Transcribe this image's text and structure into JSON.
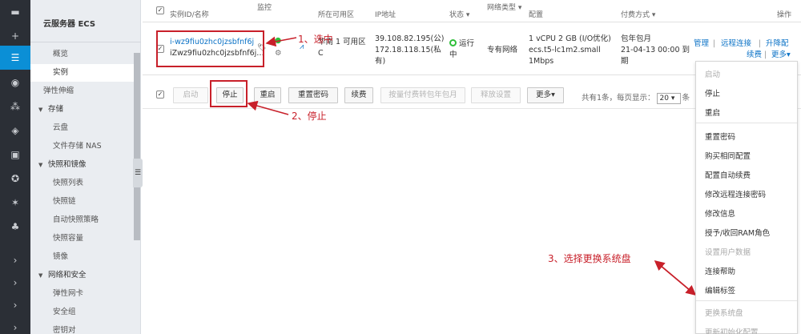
{
  "sidebar": {
    "title": "云服务器 ECS",
    "items": [
      {
        "label": "概览",
        "kind": "item"
      },
      {
        "label": "实例",
        "kind": "item",
        "active": true
      },
      {
        "label": "弹性伸缩",
        "kind": "item"
      },
      {
        "label": "存储",
        "kind": "group"
      },
      {
        "label": "云盘",
        "kind": "sub"
      },
      {
        "label": "文件存储 NAS",
        "kind": "sub"
      },
      {
        "label": "快照和镜像",
        "kind": "group"
      },
      {
        "label": "快照列表",
        "kind": "sub"
      },
      {
        "label": "快照链",
        "kind": "sub"
      },
      {
        "label": "自动快照策略",
        "kind": "sub"
      },
      {
        "label": "快照容量",
        "kind": "sub"
      },
      {
        "label": "镜像",
        "kind": "sub"
      },
      {
        "label": "网络和安全",
        "kind": "group"
      },
      {
        "label": "弹性网卡",
        "kind": "sub"
      },
      {
        "label": "安全组",
        "kind": "sub"
      },
      {
        "label": "密钥对",
        "kind": "sub"
      }
    ]
  },
  "table": {
    "headers": {
      "id": "实例ID/名称",
      "monitor": "监控",
      "zone": "所在可用区",
      "ip": "IP地址",
      "status": "状态 ▾",
      "network": "网络类型 ▾",
      "config": "配置",
      "billing": "付费方式 ▾",
      "ops": "操作"
    },
    "row": {
      "id_line1": "i-wz9fiu0zhc0jzsbfnf6j",
      "id_line2": "iZwz9fiu0zhc0jzsbfnf6j…",
      "zone_line1": "华南 1 可用区",
      "zone_line2": "C",
      "ip_line1": "39.108.82.195(公)",
      "ip_line2": "172.18.118.15(私",
      "ip_line3": "有)",
      "status_line1": "运行",
      "status_line2": "中",
      "network": "专有网络",
      "config_line1": "1 vCPU 2 GB (I/O优化)",
      "config_line2": "ecs.t5-lc1m2.small",
      "config_line3": "1Mbps",
      "billing_line1": "包年包月",
      "billing_line2": "21-04-13 00:00 到",
      "billing_line3": "期",
      "op_manage": "管理",
      "op_remote": "远程连接",
      "op_upgrade": "升降配",
      "op_renew": "续费",
      "op_more": "更多▾"
    }
  },
  "toolbar": {
    "start": "启动",
    "stop": "停止",
    "restart": "重启",
    "reset_pwd": "重置密码",
    "renew": "续费",
    "convert": "按量付费转包年包月",
    "release": "释放设置",
    "more": "更多▾",
    "pager_prefix": "共有1条，每页显示：",
    "page_size": "20 ▾",
    "pager_suffix": "条"
  },
  "annotations": {
    "step1": "1、选中",
    "step2": "2、停止",
    "step3": "3、选择更换系统盘"
  },
  "dropdown": {
    "items": [
      {
        "label": "启动",
        "disabled": true
      },
      {
        "label": "停止"
      },
      {
        "label": "重启"
      },
      {
        "label": "重置密码"
      },
      {
        "label": "购买相同配置"
      },
      {
        "label": "配置自动续费"
      },
      {
        "label": "修改远程连接密码"
      },
      {
        "label": "修改信息"
      },
      {
        "label": "授予/收回RAM角色"
      },
      {
        "label": "设置用户数据",
        "disabled": true
      },
      {
        "label": "连接帮助"
      },
      {
        "label": "编辑标签"
      },
      {
        "label": "更换系统盘",
        "disabled": true
      },
      {
        "label": "更新初始化配置",
        "disabled": true
      }
    ]
  },
  "colors": {
    "accent": "#0b8fd6",
    "annotation": "#c8202a",
    "running": "#2fbf3a"
  }
}
